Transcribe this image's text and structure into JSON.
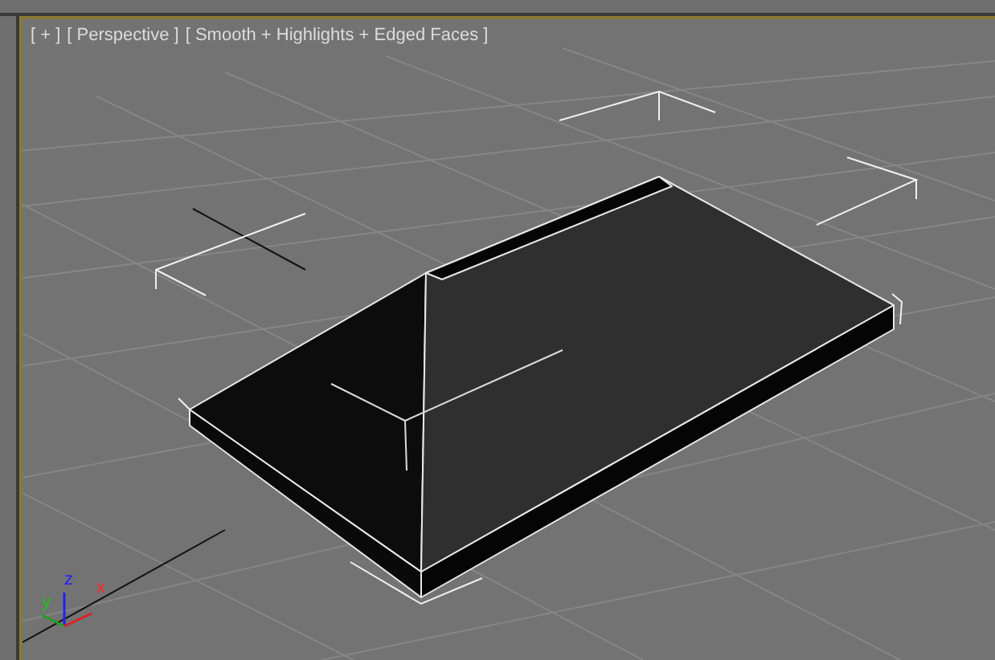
{
  "viewport": {
    "labels": [
      {
        "text": "[ + ]"
      },
      {
        "text": "[ Perspective ]"
      },
      {
        "text": "[ Smooth + Highlights + Edged Faces ]"
      }
    ],
    "axis_labels": [
      {
        "text": "z",
        "color": "#2020ff"
      },
      {
        "text": "y",
        "color": "#20c020"
      },
      {
        "text": "x",
        "color": "#ff2a2a"
      }
    ]
  }
}
